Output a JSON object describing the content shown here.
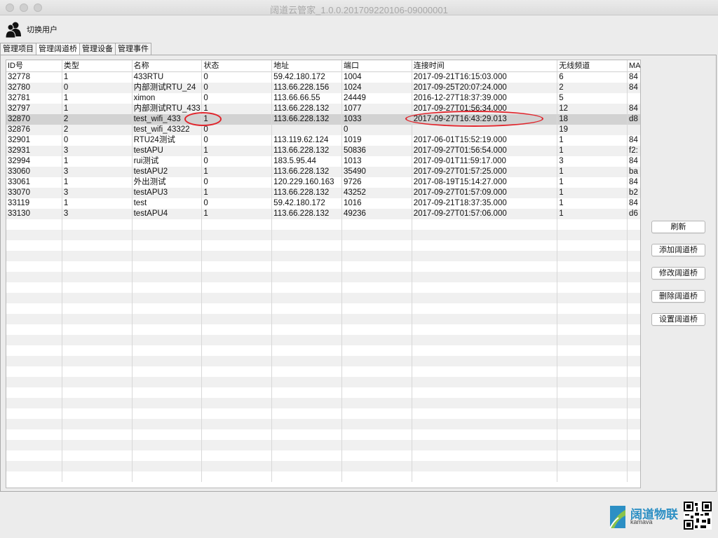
{
  "window": {
    "title": "阔道云管家_1.0.0.201709220106-09000001"
  },
  "header": {
    "switch_user_label": "切换用户"
  },
  "tabs": [
    "管理项目",
    "管理阔道桥",
    "管理设备",
    "管理事件"
  ],
  "table": {
    "columns": [
      "ID号",
      "类型",
      "名称",
      "状态",
      "地址",
      "端口",
      "连接时间",
      "无线频道",
      "MA"
    ],
    "rows": [
      [
        "32778",
        "1",
        "433RTU",
        "0",
        "59.42.180.172",
        "1004",
        "2017-09-21T16:15:03.000",
        "6",
        "84"
      ],
      [
        "32780",
        "0",
        "内部测试RTU_24",
        "0",
        "113.66.228.156",
        "1024",
        "2017-09-25T20:07:24.000",
        "2",
        "84"
      ],
      [
        "32781",
        "1",
        "ximon",
        "0",
        "113.66.66.55",
        "24449",
        "2016-12-27T18:37:39.000",
        "5",
        ""
      ],
      [
        "32797",
        "1",
        "内部测试RTU_433",
        "1",
        "113.66.228.132",
        "1077",
        "2017-09-27T01:56:34.000",
        "12",
        "84"
      ],
      [
        "32870",
        "2",
        "test_wifi_433",
        "1",
        "113.66.228.132",
        "1033",
        "2017-09-27T16:43:29.013",
        "18",
        "d8"
      ],
      [
        "32876",
        "2",
        "test_wifi_43322",
        "0",
        "",
        "0",
        "",
        "19",
        ""
      ],
      [
        "32901",
        "0",
        "RTU24测试",
        "0",
        "113.119.62.124",
        "1019",
        "2017-06-01T15:52:19.000",
        "1",
        "84"
      ],
      [
        "32931",
        "3",
        "testAPU",
        "1",
        "113.66.228.132",
        "50836",
        "2017-09-27T01:56:54.000",
        "1",
        "f2:"
      ],
      [
        "32994",
        "1",
        "rui测试",
        "0",
        "183.5.95.44",
        "1013",
        "2017-09-01T11:59:17.000",
        "3",
        "84"
      ],
      [
        "33060",
        "3",
        "testAPU2",
        "1",
        "113.66.228.132",
        "35490",
        "2017-09-27T01:57:25.000",
        "1",
        "ba"
      ],
      [
        "33061",
        "1",
        "外出测试",
        "0",
        "120.229.160.163",
        "9726",
        "2017-08-19T15:14:27.000",
        "1",
        "84"
      ],
      [
        "33070",
        "3",
        "testAPU3",
        "1",
        "113.66.228.132",
        "43252",
        "2017-09-27T01:57:09.000",
        "1",
        "b2"
      ],
      [
        "33119",
        "1",
        "test",
        "0",
        "59.42.180.172",
        "1016",
        "2017-09-21T18:37:35.000",
        "1",
        "84"
      ],
      [
        "33130",
        "3",
        "testAPU4",
        "1",
        "113.66.228.132",
        "49236",
        "2017-09-27T01:57:06.000",
        "1",
        "d6"
      ]
    ],
    "selected_index": 4
  },
  "buttons": [
    "刷新",
    "添加阔道桥",
    "修改阔道桥",
    "删除阔道桥",
    "设置阔道桥"
  ],
  "logo": {
    "name": "阔道物联",
    "sub": "kamava"
  },
  "colors": {
    "annotation": "#e0242b",
    "brand": "#2c8fc4"
  },
  "icons": [
    "user-group-icon",
    "qr-code-icon",
    "brand-logo-icon"
  ]
}
